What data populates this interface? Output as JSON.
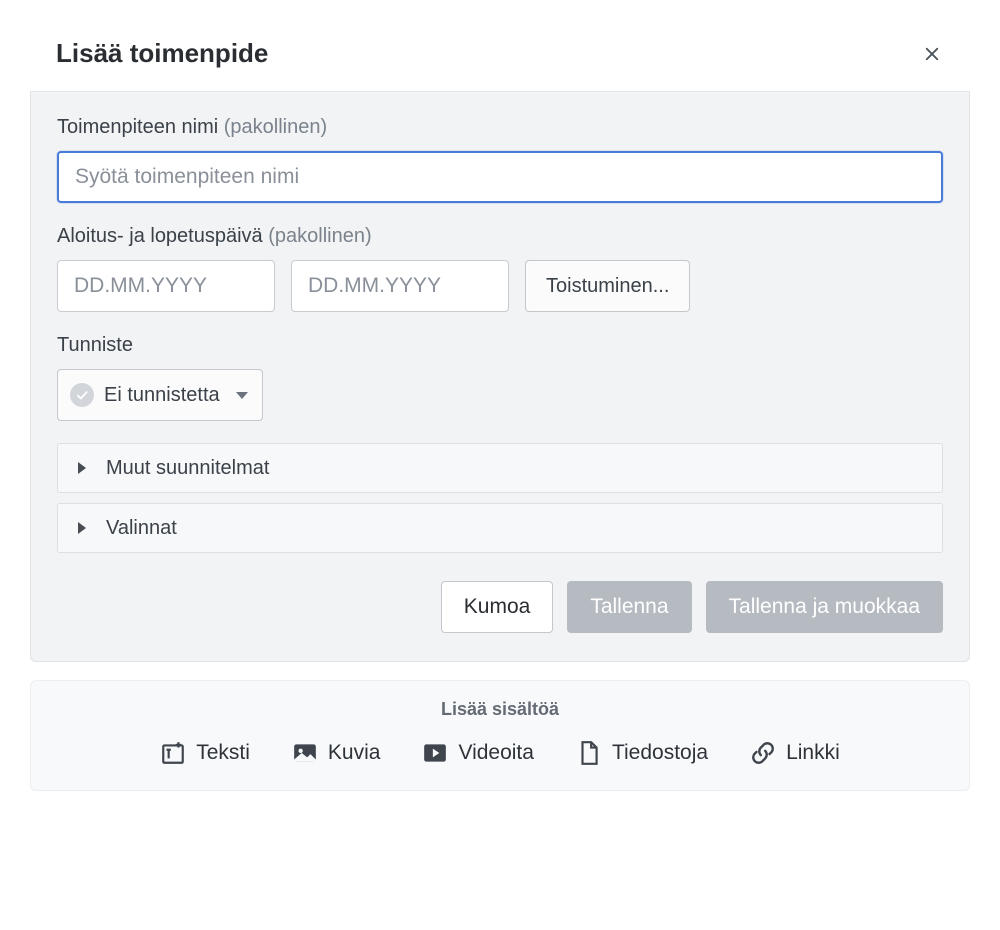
{
  "dialog": {
    "title": "Lisää toimenpide"
  },
  "fields": {
    "name": {
      "label": "Toimenpiteen nimi",
      "required_hint": "(pakollinen)",
      "placeholder": "Syötä toimenpiteen nimi",
      "value": ""
    },
    "dates": {
      "label": "Aloitus- ja lopetuspäivä",
      "required_hint": "(pakollinen)",
      "start_placeholder": "DD.MM.YYYY",
      "end_placeholder": "DD.MM.YYYY",
      "recurrence_button": "Toistuminen..."
    },
    "tag": {
      "label": "Tunniste",
      "selected": "Ei tunnistetta"
    }
  },
  "collapsibles": {
    "other_plans": "Muut suunnitelmat",
    "options": "Valinnat"
  },
  "buttons": {
    "cancel": "Kumoa",
    "save": "Tallenna",
    "save_and_edit": "Tallenna ja muokkaa"
  },
  "add_content": {
    "title": "Lisää sisältöä",
    "text": "Teksti",
    "images": "Kuvia",
    "videos": "Videoita",
    "files": "Tiedostoja",
    "link": "Linkki"
  }
}
